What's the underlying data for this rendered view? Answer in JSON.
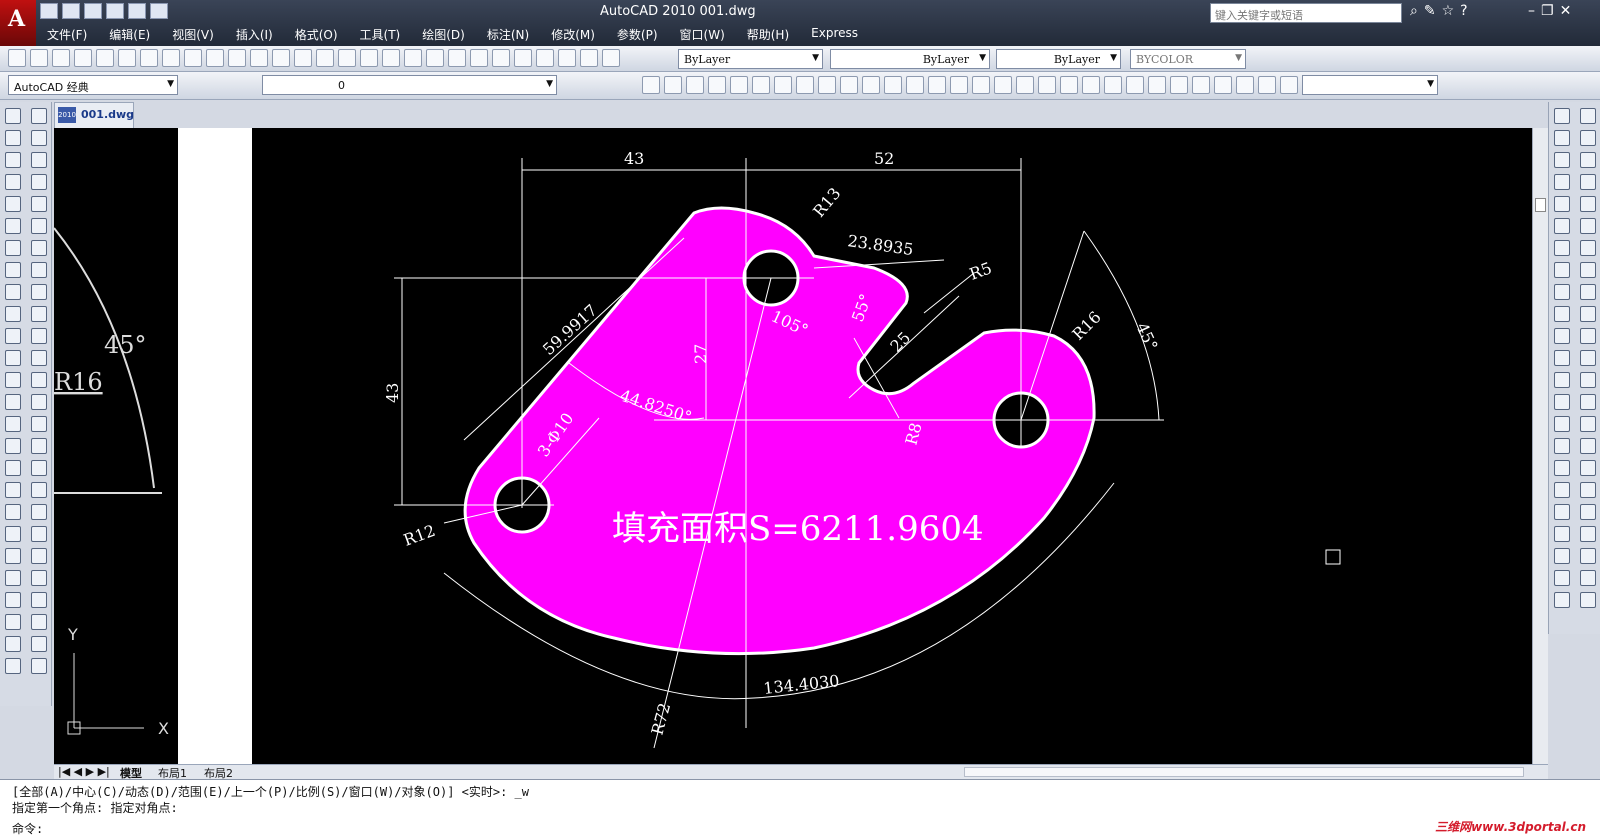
{
  "titlebar": {
    "title": "AutoCAD 2010      001.dwg",
    "search_placeholder": "键入关键字或短语",
    "app_letter": "A"
  },
  "menu": [
    "文件(F)",
    "编辑(E)",
    "视图(V)",
    "插入(I)",
    "格式(O)",
    "工具(T)",
    "绘图(D)",
    "标注(N)",
    "修改(M)",
    "参数(P)",
    "窗口(W)",
    "帮助(H)",
    "Express"
  ],
  "properties": {
    "layer": "ByLayer",
    "linetype": "ByLayer",
    "lineweight": "ByLayer",
    "plotstyle": "BYCOLOR"
  },
  "workspace": "AutoCAD 经典",
  "layer_current": "0",
  "doc_tab": {
    "label": "001.dwg",
    "badge": "2010"
  },
  "layout_tabs": [
    "模型",
    "布局1",
    "布局2"
  ],
  "drawing": {
    "dims": {
      "d43a": "43",
      "d52": "52",
      "r13": "R13",
      "d238935": "23.8935",
      "r5": "R5",
      "d599917": "59.9917",
      "d27": "27",
      "d105": "105°",
      "d55": "55°",
      "d25": "25",
      "r16": "R16",
      "d45": "45°",
      "d43b": "43",
      "d448250": "44.8250°",
      "phi10": "3-Φ10",
      "r8": "R8",
      "r12": "R12",
      "r72": "R72",
      "d1344030": "134.4030"
    },
    "area_text": "填充面积S=6211.9604",
    "left_dims": {
      "a45": "45°",
      "r16": "R16"
    },
    "ucs": {
      "x": "X",
      "y": "Y"
    },
    "fill_color": "#ff00ff"
  },
  "command": [
    "[全部(A)/中心(C)/动态(D)/范围(E)/上一个(P)/比例(S)/窗口(W)/对象(O)] <实时>: _w",
    "指定第一个角点: 指定对角点:",
    "命令:"
  ],
  "watermark": "三维网www.3dportal.cn"
}
